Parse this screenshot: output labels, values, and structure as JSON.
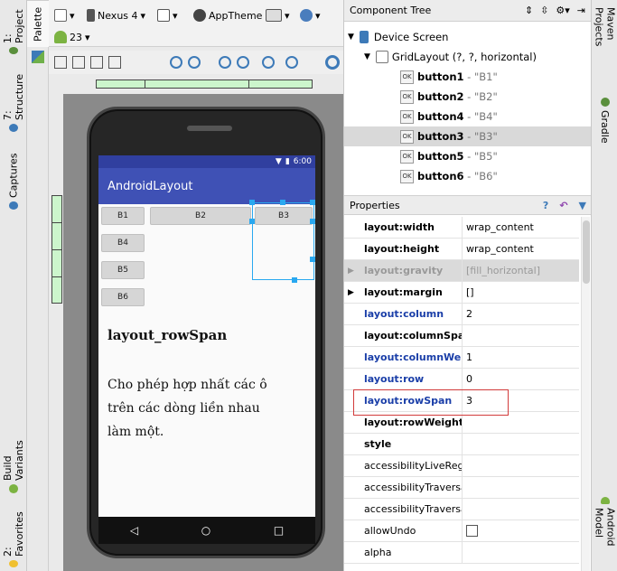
{
  "left_strip": {
    "tabs": [
      "1: Project",
      "7: Structure",
      "Captures",
      "Build Variants",
      "2: Favorites"
    ]
  },
  "palette": {
    "tab_label": "Palette"
  },
  "toolbar": {
    "device": "Nexus 4",
    "api": "23",
    "theme": "AppTheme"
  },
  "phone": {
    "time": "6:00",
    "app_title": "AndroidLayout",
    "buttons": {
      "b1": "B1",
      "b2": "B2",
      "b3": "B3",
      "b4": "B4",
      "b5": "B5",
      "b6": "B6"
    },
    "heading": "layout_rowSpan",
    "body_line1": "Cho phép hợp nhất các ô",
    "body_line2": "trên các dòng liền nhau",
    "body_line3": "làm một."
  },
  "component_tree": {
    "title": "Component Tree",
    "device_screen": "Device Screen",
    "grid_layout": "GridLayout (?, ?, horizontal)",
    "items": [
      {
        "name": "button1",
        "value": "- \"B1\""
      },
      {
        "name": "button2",
        "value": "- \"B2\""
      },
      {
        "name": "button4",
        "value": "- \"B4\""
      },
      {
        "name": "button3",
        "value": "- \"B3\""
      },
      {
        "name": "button5",
        "value": "- \"B5\""
      },
      {
        "name": "button6",
        "value": "- \"B6\""
      }
    ]
  },
  "properties": {
    "title": "Properties",
    "rows": [
      {
        "name": "layout:width",
        "value": "wrap_content"
      },
      {
        "name": "layout:height",
        "value": "wrap_content"
      },
      {
        "name": "layout:gravity",
        "value": "[fill_horizontal]"
      },
      {
        "name": "layout:margin",
        "value": "[]"
      },
      {
        "name": "layout:column",
        "value": "2"
      },
      {
        "name": "layout:columnSpan",
        "value": ""
      },
      {
        "name": "layout:columnWeight",
        "value": "1"
      },
      {
        "name": "layout:row",
        "value": "0"
      },
      {
        "name": "layout:rowSpan",
        "value": "3"
      },
      {
        "name": "layout:rowWeight",
        "value": ""
      },
      {
        "name": "style",
        "value": ""
      },
      {
        "name": "accessibilityLiveRegion",
        "value": ""
      },
      {
        "name": "accessibilityTraversalAfter",
        "value": ""
      },
      {
        "name": "accessibilityTraversalBefore",
        "value": ""
      },
      {
        "name": "allowUndo",
        "value": ""
      },
      {
        "name": "alpha",
        "value": ""
      }
    ]
  },
  "right_strip": {
    "tabs": [
      "Maven Projects",
      "Gradle",
      "Android Model"
    ]
  }
}
